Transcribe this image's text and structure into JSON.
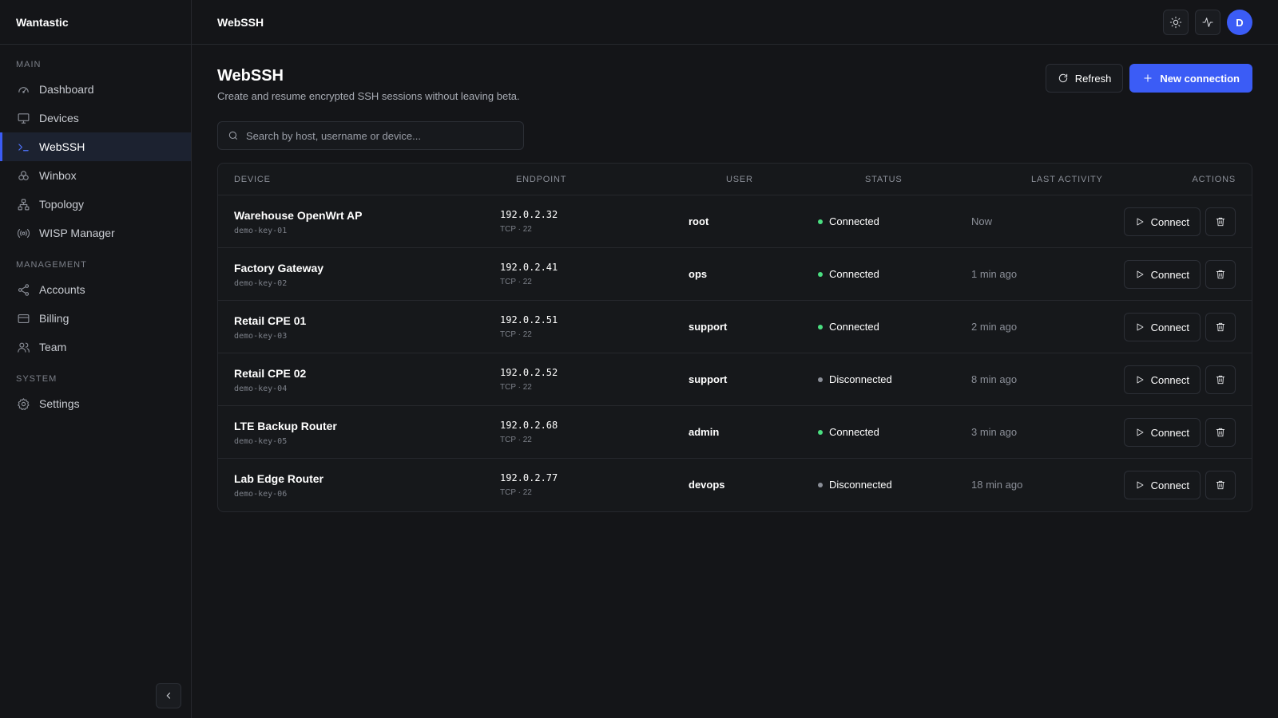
{
  "app": {
    "brand": "Wantastic"
  },
  "sidebar": {
    "sections": {
      "main": "MAIN",
      "management": "MANAGEMENT",
      "system": "SYSTEM"
    },
    "items": {
      "dashboard": "Dashboard",
      "devices": "Devices",
      "webssh": "WebSSH",
      "winbox": "Winbox",
      "topology": "Topology",
      "wisp": "WISP Manager",
      "accounts": "Accounts",
      "billing": "Billing",
      "team": "Team",
      "settings": "Settings"
    },
    "active": "webssh"
  },
  "topbar": {
    "title": "WebSSH",
    "avatar_initial": "D"
  },
  "page": {
    "title": "WebSSH",
    "subtitle": "Create and resume encrypted SSH sessions without leaving beta.",
    "refresh_label": "Refresh",
    "new_connection_label": "New connection"
  },
  "search": {
    "placeholder": "Search by host, username or device..."
  },
  "table": {
    "headers": {
      "device": "DEVICE",
      "endpoint": "ENDPOINT",
      "user": "USER",
      "status": "STATUS",
      "last_activity": "LAST ACTIVITY",
      "actions": "ACTIONS"
    },
    "connect_label": "Connect",
    "rows": [
      {
        "name": "Warehouse OpenWrt AP",
        "key": "demo-key-01",
        "ip": "192.0.2.32",
        "proto": "TCP · 22",
        "user": "root",
        "status": "Connected",
        "activity": "Now"
      },
      {
        "name": "Factory Gateway",
        "key": "demo-key-02",
        "ip": "192.0.2.41",
        "proto": "TCP · 22",
        "user": "ops",
        "status": "Connected",
        "activity": "1 min ago"
      },
      {
        "name": "Retail CPE 01",
        "key": "demo-key-03",
        "ip": "192.0.2.51",
        "proto": "TCP · 22",
        "user": "support",
        "status": "Connected",
        "activity": "2 min ago"
      },
      {
        "name": "Retail CPE 02",
        "key": "demo-key-04",
        "ip": "192.0.2.52",
        "proto": "TCP · 22",
        "user": "support",
        "status": "Disconnected",
        "activity": "8 min ago"
      },
      {
        "name": "LTE Backup Router",
        "key": "demo-key-05",
        "ip": "192.0.2.68",
        "proto": "TCP · 22",
        "user": "admin",
        "status": "Connected",
        "activity": "3 min ago"
      },
      {
        "name": "Lab Edge Router",
        "key": "demo-key-06",
        "ip": "192.0.2.77",
        "proto": "TCP · 22",
        "user": "devops",
        "status": "Disconnected",
        "activity": "18 min ago"
      }
    ]
  },
  "colors": {
    "accent": "#3b5cf6",
    "connected": "#4ade80",
    "disconnected": "#8b8f98",
    "background": "#141518"
  }
}
